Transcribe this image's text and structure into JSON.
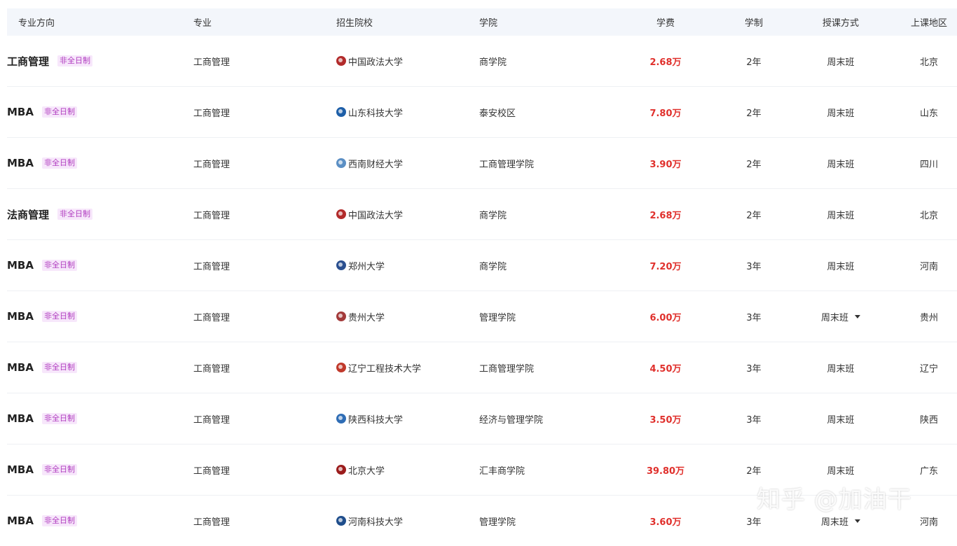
{
  "header": {
    "direction": "专业方向",
    "major": "专业",
    "school": "招生院校",
    "college": "学院",
    "fee": "学费",
    "duration": "学制",
    "mode": "授课方式",
    "region": "上课地区"
  },
  "rows": [
    {
      "direction": "工商管理",
      "badge": "非全日制",
      "major": "工商管理",
      "school": "中国政法大学",
      "school_logo_color": "#b22b2b",
      "college": "商学院",
      "fee": "2.68万",
      "duration": "2年",
      "mode": "周末班",
      "mode_dropdown": false,
      "region": "北京"
    },
    {
      "direction": "MBA",
      "badge": "非全日制",
      "major": "工商管理",
      "school": "山东科技大学",
      "school_logo_color": "#1e5fa8",
      "college": "泰安校区",
      "fee": "7.80万",
      "duration": "2年",
      "mode": "周末班",
      "mode_dropdown": false,
      "region": "山东"
    },
    {
      "direction": "MBA",
      "badge": "非全日制",
      "major": "工商管理",
      "school": "西南财经大学",
      "school_logo_color": "#5b8fc4",
      "college": "工商管理学院",
      "fee": "3.90万",
      "duration": "2年",
      "mode": "周末班",
      "mode_dropdown": false,
      "region": "四川"
    },
    {
      "direction": "法商管理",
      "badge": "非全日制",
      "major": "工商管理",
      "school": "中国政法大学",
      "school_logo_color": "#b22b2b",
      "college": "商学院",
      "fee": "2.68万",
      "duration": "2年",
      "mode": "周末班",
      "mode_dropdown": false,
      "region": "北京"
    },
    {
      "direction": "MBA",
      "badge": "非全日制",
      "major": "工商管理",
      "school": "郑州大学",
      "school_logo_color": "#2a4f8f",
      "college": "商学院",
      "fee": "7.20万",
      "duration": "3年",
      "mode": "周末班",
      "mode_dropdown": false,
      "region": "河南"
    },
    {
      "direction": "MBA",
      "badge": "非全日制",
      "major": "工商管理",
      "school": "贵州大学",
      "school_logo_color": "#a33a3a",
      "college": "管理学院",
      "fee": "6.00万",
      "duration": "3年",
      "mode": "周末班",
      "mode_dropdown": true,
      "region": "贵州"
    },
    {
      "direction": "MBA",
      "badge": "非全日制",
      "major": "工商管理",
      "school": "辽宁工程技术大学",
      "school_logo_color": "#c0392b",
      "college": "工商管理学院",
      "fee": "4.50万",
      "duration": "3年",
      "mode": "周末班",
      "mode_dropdown": false,
      "region": "辽宁"
    },
    {
      "direction": "MBA",
      "badge": "非全日制",
      "major": "工商管理",
      "school": "陕西科技大学",
      "school_logo_color": "#2f6db5",
      "college": "经济与管理学院",
      "fee": "3.50万",
      "duration": "3年",
      "mode": "周末班",
      "mode_dropdown": false,
      "region": "陕西"
    },
    {
      "direction": "MBA",
      "badge": "非全日制",
      "major": "工商管理",
      "school": "北京大学",
      "school_logo_color": "#9b1c1c",
      "college": "汇丰商学院",
      "fee": "39.80万",
      "duration": "2年",
      "mode": "周末班",
      "mode_dropdown": false,
      "region": "广东"
    },
    {
      "direction": "MBA",
      "badge": "非全日制",
      "major": "工商管理",
      "school": "河南科技大学",
      "school_logo_color": "#1f4e8c",
      "college": "管理学院",
      "fee": "3.60万",
      "duration": "3年",
      "mode": "周末班",
      "mode_dropdown": true,
      "region": "河南"
    }
  ],
  "watermark": "知乎 @加油干"
}
